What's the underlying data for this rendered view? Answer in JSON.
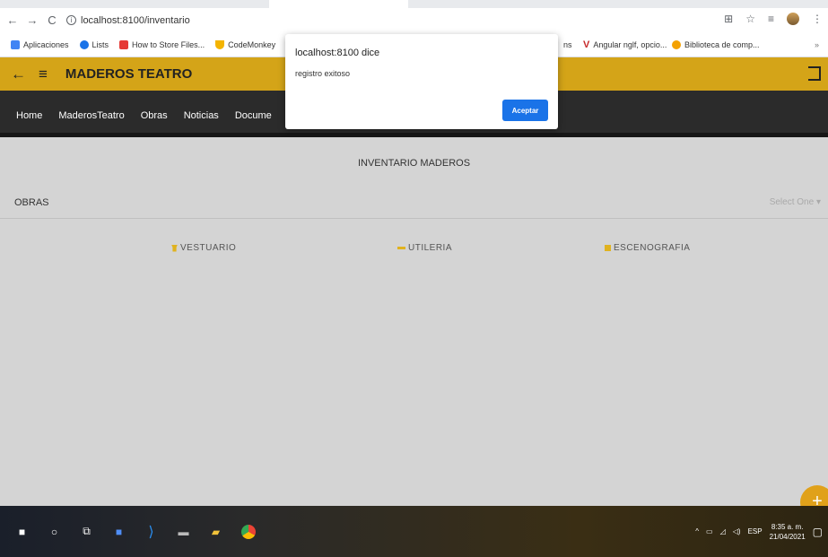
{
  "browser": {
    "url": "localhost:8100/inventario",
    "bookmarks": [
      {
        "label": "Aplicaciones",
        "color": "#4285f4"
      },
      {
        "label": "Lists",
        "color": "#1a73e8"
      },
      {
        "label": "How to Store Files...",
        "color": "#e53935"
      },
      {
        "label": "CodeMonkey",
        "color": "#f4b400"
      }
    ],
    "bookmarks_right": [
      {
        "label": "ns",
        "color": "#ffffff"
      },
      {
        "label": "Angular nglf, opcio...",
        "color": "#c62828"
      },
      {
        "label": "Biblioteca de comp...",
        "color": "#f4a100"
      }
    ],
    "more": "»"
  },
  "app": {
    "title": "MADEROS TEATRO",
    "accent": "#d4a418",
    "nav": [
      "Home",
      "MaderosTeatro",
      "Obras",
      "Noticias",
      "Docume"
    ]
  },
  "content": {
    "title": "INVENTARIO MADEROS",
    "obras_label": "OBRAS",
    "select_placeholder": "Select One",
    "categories": [
      {
        "label": "VESTUARIO",
        "icon": "shirt-icon"
      },
      {
        "label": "UTILERIA",
        "icon": "tool-icon"
      },
      {
        "label": "ESCENOGRAFIA",
        "icon": "scene-icon"
      }
    ]
  },
  "dialog": {
    "title": "localhost:8100 dice",
    "message": "registro exitoso",
    "button": "Aceptar"
  },
  "taskbar": {
    "language": "ESP",
    "time": "8:35 a. m.",
    "date": "21/04/2021"
  }
}
